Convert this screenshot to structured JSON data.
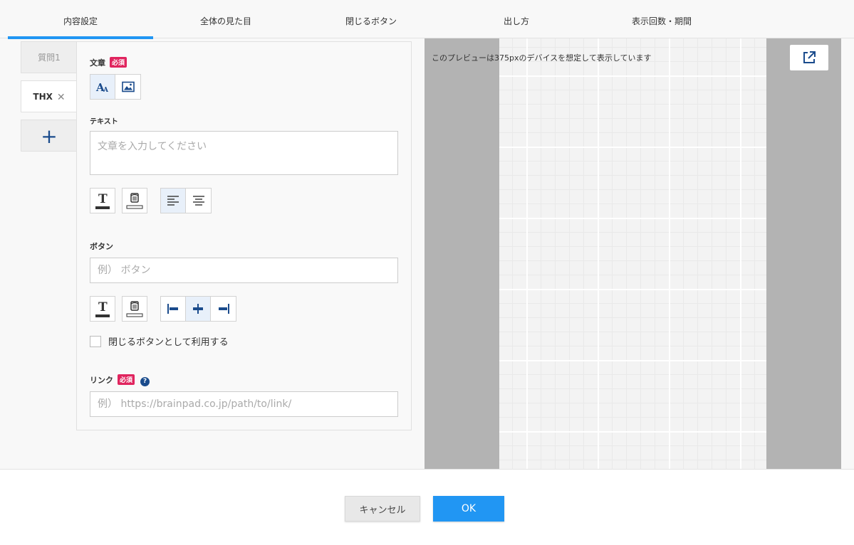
{
  "tabs": [
    {
      "label": "内容設定",
      "active": true
    },
    {
      "label": "全体の見た目",
      "active": false
    },
    {
      "label": "閉じるボタン",
      "active": false
    },
    {
      "label": "出し方",
      "active": false
    },
    {
      "label": "表示回数・期間",
      "active": false
    }
  ],
  "questions": {
    "q1_label": "質問1",
    "thx_label": "THX",
    "close_glyph": "✕",
    "add_glyph": "+"
  },
  "form": {
    "sentence_label": "文章",
    "required_badge": "必須",
    "text_label": "テキスト",
    "text_placeholder": "文章を入力してください",
    "button_label": "ボタン",
    "button_placeholder": "例） ボタン",
    "close_checkbox_label": "閉じるボタンとして利用する",
    "close_checkbox_checked": false,
    "link_label": "リンク",
    "help_glyph": "?",
    "link_placeholder": "例） https://brainpad.co.jp/path/to/link/"
  },
  "preview": {
    "note": "このプレビューは375pxのデバイスを想定して表示しています"
  },
  "footer": {
    "cancel_label": "キャンセル",
    "ok_label": "OK"
  },
  "colors": {
    "accent": "#2196f3",
    "required": "#e0245e",
    "icon": "#1a4b8c"
  }
}
